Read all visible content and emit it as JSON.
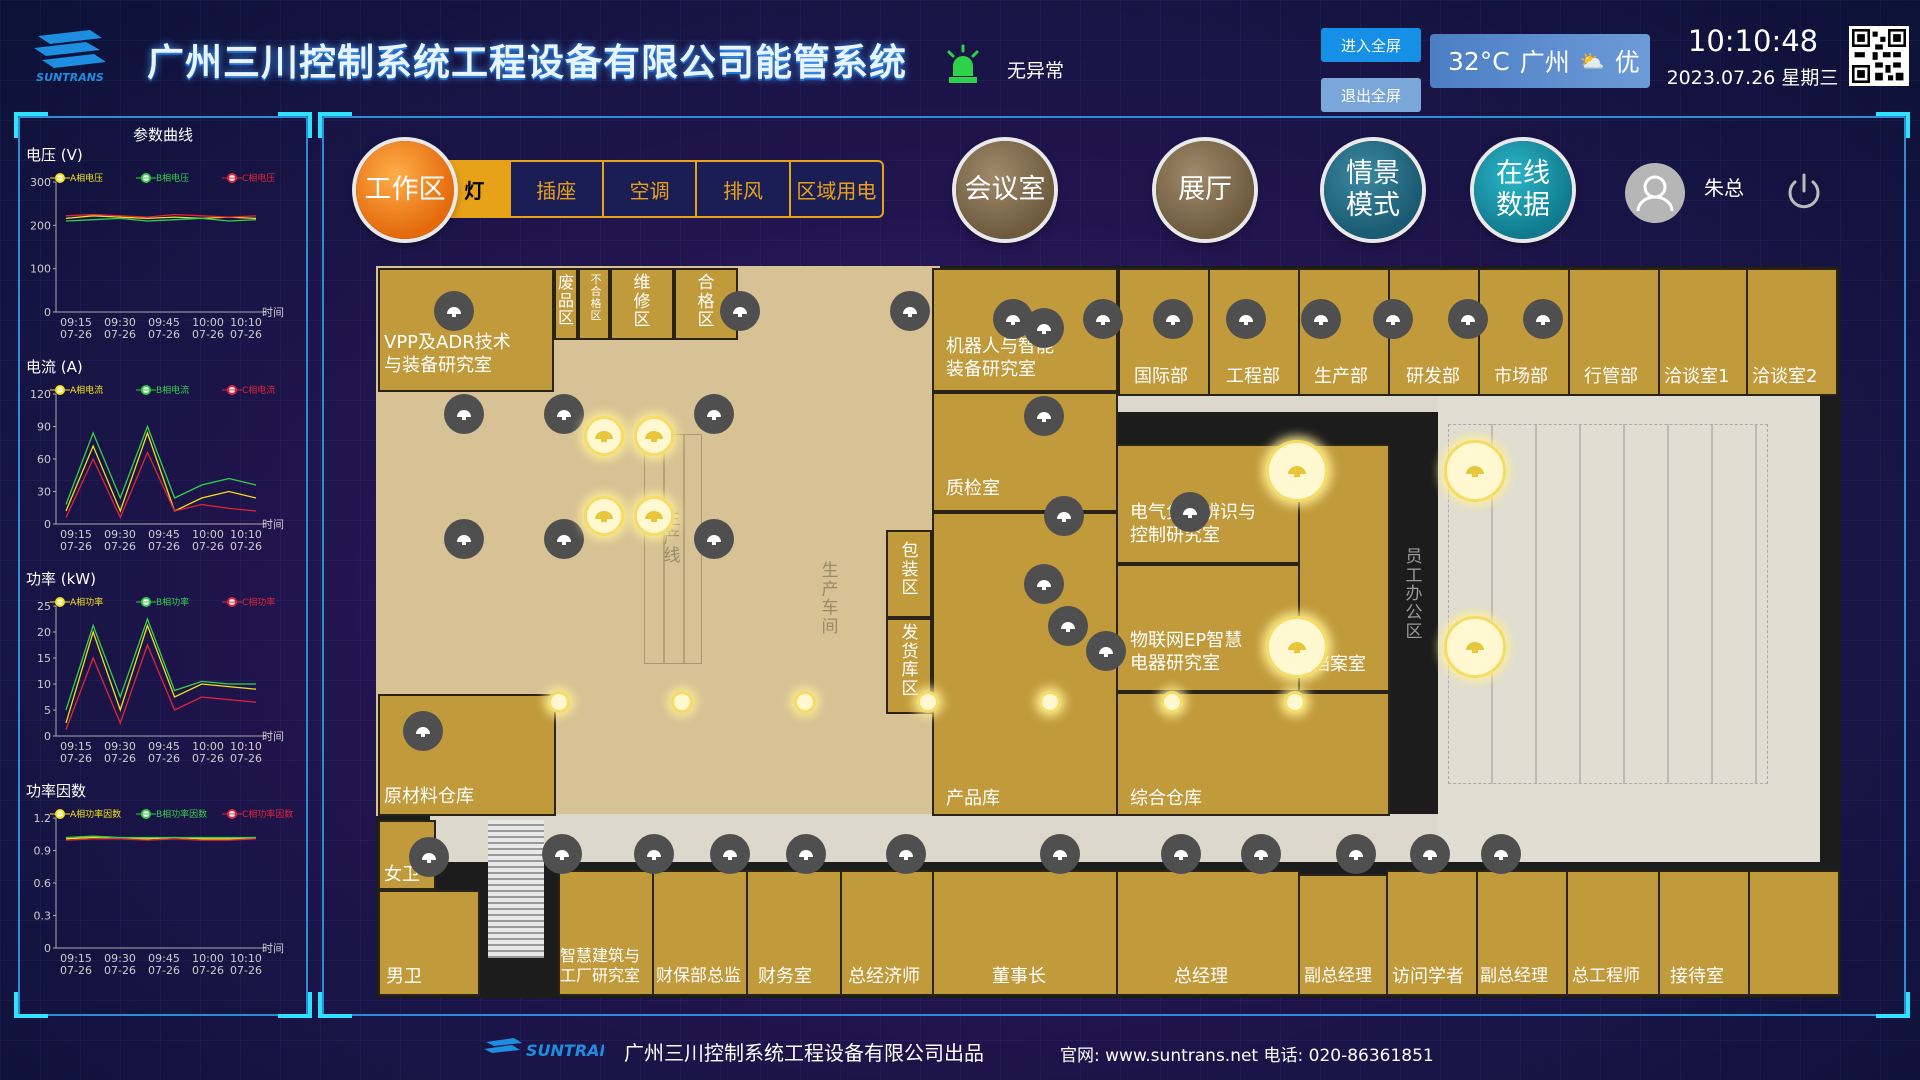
{
  "header": {
    "title": "广州三川控制系统工程设备有限公司能管系统",
    "status": "无异常",
    "enter_fullscreen": "进入全屏",
    "exit_fullscreen": "退出全屏",
    "weather_temp": "32°C",
    "weather_city": "广州",
    "weather_air": "优",
    "time": "10:10:48",
    "date": "2023.07.26 星期三",
    "logo_text": "SUNTRANS"
  },
  "left_panel": {
    "title": "参数曲线",
    "charts": [
      {
        "title": "电压 (V)",
        "legend": [
          "A相电压",
          "B相电压",
          "C相电压"
        ],
        "ylim": [
          0,
          300
        ],
        "yticks": [
          "300",
          "200",
          "100",
          "0"
        ],
        "xticks": [
          "09:15\n07-26",
          "09:30\n07-26",
          "09:45\n07-26",
          "10:00\n07-26",
          "10:10\n07-26"
        ],
        "xlabel": "时间"
      },
      {
        "title": "电流 (A)",
        "legend": [
          "A相电流",
          "B相电流",
          "C相电流"
        ],
        "ylim": [
          0,
          120
        ],
        "yticks": [
          "120",
          "90",
          "60",
          "30",
          "0"
        ],
        "xticks": [
          "09:15\n07-26",
          "09:30\n07-26",
          "09:45\n07-26",
          "10:00\n07-26",
          "10:10\n07-26"
        ],
        "xlabel": "时间"
      },
      {
        "title": "功率 (kW)",
        "legend": [
          "A相功率",
          "B相功率",
          "C相功率"
        ],
        "ylim": [
          0,
          25
        ],
        "yticks": [
          "25",
          "20",
          "15",
          "10",
          "5",
          "0"
        ],
        "xticks": [
          "09:15\n07-26",
          "09:30\n07-26",
          "09:45\n07-26",
          "10:00\n07-26",
          "10:10\n07-26"
        ],
        "xlabel": "时间"
      },
      {
        "title": "功率因数",
        "legend": [
          "A相功率因数",
          "B相功率因数",
          "C相功率因数"
        ],
        "ylim": [
          0,
          1.2
        ],
        "yticks": [
          "1.2",
          "0.9",
          "0.6",
          "0.3",
          "0"
        ],
        "xticks": [
          "09:15\n07-26",
          "09:30\n07-26",
          "09:45\n07-26",
          "10:00\n07-26",
          "10:10\n07-26"
        ],
        "xlabel": "时间"
      }
    ]
  },
  "nav": {
    "work_area": "工作区",
    "tabs": [
      "灯",
      "插座",
      "空调",
      "排风",
      "区域用电"
    ],
    "meeting": "会议室",
    "hall": "展厅",
    "scene": "情景\n模式",
    "online": "在线\n数据",
    "user": "朱总"
  },
  "rooms": {
    "vpp": "VPP及ADR技术\n与装备研究室",
    "waste": "废品区",
    "unqualified": "不合格区",
    "repair": "维修区",
    "qualified": "合格区",
    "production_line": "生产线",
    "workshop": "生产车间",
    "robot": "机器人与智能\n装备研究室",
    "qc": "质检室",
    "international": "国际部",
    "engineering": "工程部",
    "production": "生产部",
    "rd": "研发部",
    "market": "市场部",
    "admin": "行管部",
    "nego1": "洽谈室1",
    "nego2": "洽谈室2",
    "elec_load": "电气负荷辨识与\n控制研究室",
    "iot": "物联网EP智慧\n电器研究室",
    "archive": "档案室",
    "staff_office": "员工办公区",
    "packing": "包装区",
    "shipping": "发货库区",
    "raw": "原材料仓库",
    "product": "产品库",
    "warehouse": "综合仓库",
    "female_wc": "女卫",
    "male_wc": "男卫",
    "smart_build": "智慧建筑与\n工厂研究室",
    "finance_dir": "财保部总监",
    "finance": "财务室",
    "economist": "总经济师",
    "chairman": "董事长",
    "gm": "总经理",
    "vgm1": "副总经理",
    "visitor": "访问学者",
    "vgm2": "副总经理",
    "chief_eng": "总工程师",
    "reception": "接待室"
  },
  "footer": {
    "company": "广州三川控制系统工程设备有限公司出品",
    "site": "官网: www.suntrans.net  电话: 020-86361851"
  },
  "colors": {
    "accent": "#e8a21a",
    "room": "#c09a3b",
    "phaseA": "#f2e11a",
    "phaseB": "#35d04a",
    "phaseC": "#e0243a"
  }
}
